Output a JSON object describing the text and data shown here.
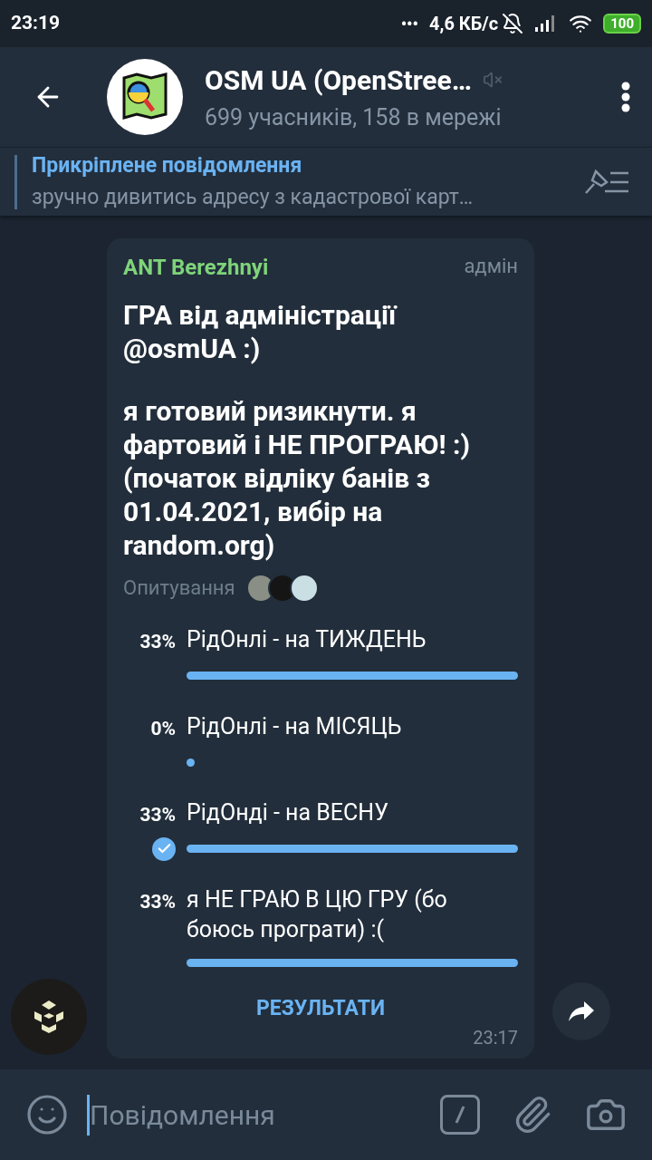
{
  "status_bar": {
    "time": "23:19",
    "dots": "•••",
    "speed": "4,6 КБ/с",
    "battery": "100"
  },
  "header": {
    "title": "OSM UA (OpenStree…",
    "subtitle": "699 учасників, 158 в мережі"
  },
  "pinned": {
    "label": "Прикріплене повідомлення",
    "text": "зручно дивитись адресу з кадастрової карт…"
  },
  "message": {
    "author": "ANT Berezhnyi",
    "role": "адмін",
    "paragraphs": [
      "ГРА від адміністрації @osmUA :)",
      "я готовий ризикнути. я фартовий і НЕ ПРОГРАЮ! :) (початок відліку банів з 01.04.2021, вибір на random.org)"
    ],
    "poll_type": "Опитування",
    "options": [
      {
        "percent": "33%",
        "text": "РідОнлі - на ТИЖДЕНЬ",
        "kind": "bar",
        "selected": false
      },
      {
        "percent": "0%",
        "text": "РідОнлі - на МІСЯЦЬ",
        "kind": "dot",
        "selected": false
      },
      {
        "percent": "33%",
        "text": "РідОнді - на ВЕСНУ",
        "kind": "bar",
        "selected": true
      },
      {
        "percent": "33%",
        "text": "я НЕ ГРАЮ В ЦЮ ГРУ (бо боюсь програти) :(",
        "kind": "bar",
        "selected": false
      }
    ],
    "results_button": "РЕЗУЛЬТАТИ",
    "time": "23:17"
  },
  "composer": {
    "placeholder": "Повідомлення"
  }
}
